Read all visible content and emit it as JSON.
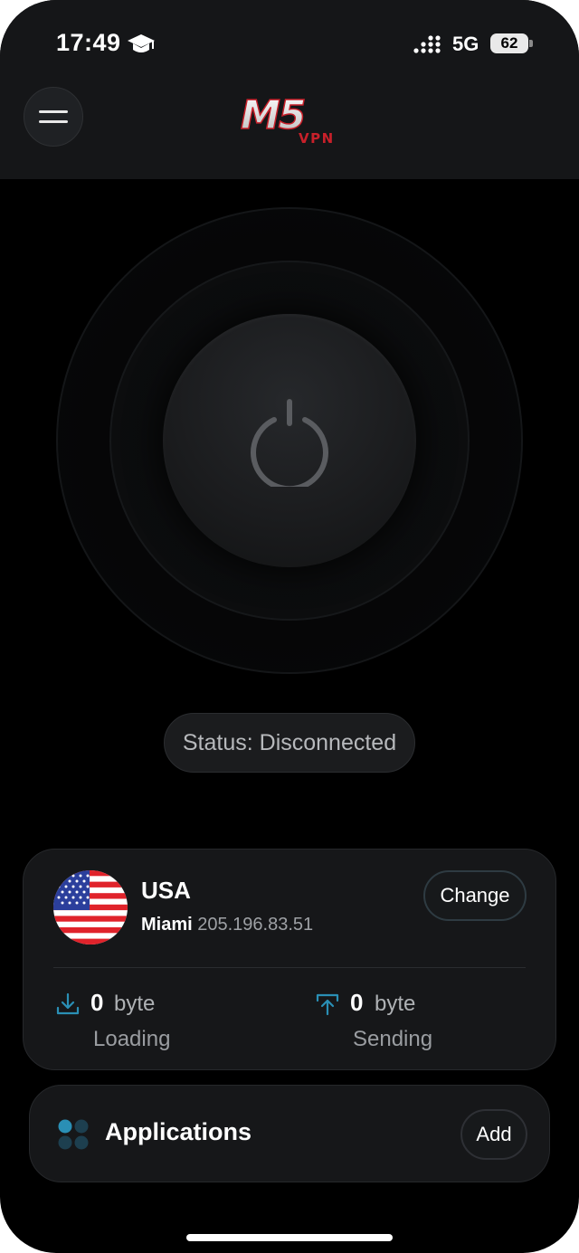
{
  "status_bar": {
    "time": "17:49",
    "network": "5G",
    "battery": "62"
  },
  "header": {
    "logo_text": "M5",
    "logo_sub": "VPN"
  },
  "power": {
    "icon": "power-icon"
  },
  "status": {
    "text": "Status: Disconnected"
  },
  "server": {
    "country": "USA",
    "city": "Miami",
    "ip": "205.196.83.51",
    "change_label": "Change",
    "flag": "usa-flag-icon"
  },
  "stats": {
    "download": {
      "value": "0",
      "unit": "byte",
      "label": "Loading",
      "icon": "download-icon"
    },
    "upload": {
      "value": "0",
      "unit": "byte",
      "label": "Sending",
      "icon": "upload-icon"
    }
  },
  "apps": {
    "title": "Applications",
    "add_label": "Add",
    "icon": "apps-grid-icon"
  },
  "colors": {
    "background": "#000000",
    "card": "#161719",
    "accent_blue": "#2a8fb5",
    "logo_red": "#c8202a"
  }
}
